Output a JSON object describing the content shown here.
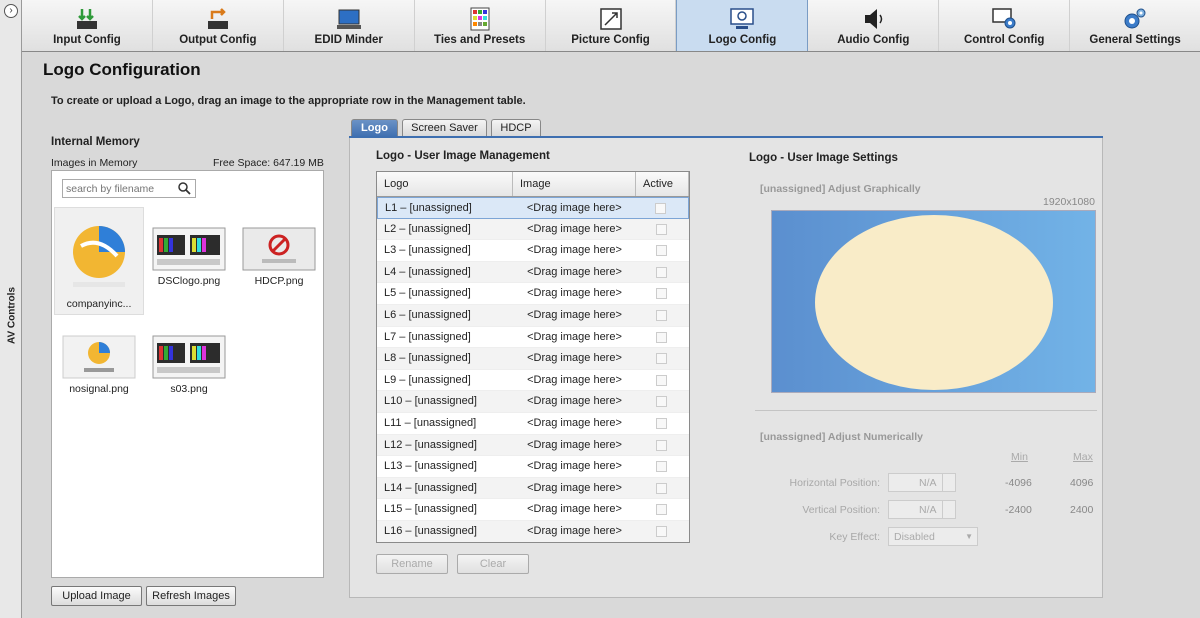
{
  "side": {
    "label": "AV Controls"
  },
  "nav": [
    {
      "label": "Input Config"
    },
    {
      "label": "Output Config"
    },
    {
      "label": "EDID Minder"
    },
    {
      "label": "Ties and Presets"
    },
    {
      "label": "Picture Config"
    },
    {
      "label": "Logo Config",
      "active": true
    },
    {
      "label": "Audio Config"
    },
    {
      "label": "Control Config"
    },
    {
      "label": "General Settings"
    }
  ],
  "page": {
    "title": "Logo Configuration",
    "instruction": "To create or upload a Logo, drag an image to the appropriate row in the Management table."
  },
  "memory": {
    "title": "Internal Memory",
    "images_label": "Images in Memory",
    "free_space": "Free Space: 647.19 MB",
    "search_placeholder": "search by filename",
    "images": [
      {
        "name": "companyinc...",
        "icon": "company-logo-icon"
      },
      {
        "name": "DSClogo.png",
        "icon": "screenshot-icon"
      },
      {
        "name": "HDCP.png",
        "icon": "no-signal-icon"
      },
      {
        "name": "nosignal.png",
        "icon": "company-logo-icon"
      },
      {
        "name": "s03.png",
        "icon": "screenshot-icon"
      }
    ],
    "upload_label": "Upload Image",
    "refresh_label": "Refresh Images"
  },
  "tabs": [
    {
      "label": "Logo",
      "active": true
    },
    {
      "label": "Screen Saver"
    },
    {
      "label": "HDCP"
    }
  ],
  "management": {
    "title": "Logo - User Image Management",
    "columns": [
      "Logo",
      "Image",
      "Active"
    ],
    "rows": [
      {
        "logo": "L1  – [unassigned]",
        "image": "<Drag image here>"
      },
      {
        "logo": "L2  – [unassigned]",
        "image": "<Drag image here>"
      },
      {
        "logo": "L3  – [unassigned]",
        "image": "<Drag image here>"
      },
      {
        "logo": "L4  – [unassigned]",
        "image": "<Drag image here>"
      },
      {
        "logo": "L5  – [unassigned]",
        "image": "<Drag image here>"
      },
      {
        "logo": "L6  – [unassigned]",
        "image": "<Drag image here>"
      },
      {
        "logo": "L7  – [unassigned]",
        "image": "<Drag image here>"
      },
      {
        "logo": "L8  – [unassigned]",
        "image": "<Drag image here>"
      },
      {
        "logo": "L9  – [unassigned]",
        "image": "<Drag image here>"
      },
      {
        "logo": "L10  – [unassigned]",
        "image": "<Drag image here>"
      },
      {
        "logo": "L11  – [unassigned]",
        "image": "<Drag image here>"
      },
      {
        "logo": "L12  – [unassigned]",
        "image": "<Drag image here>"
      },
      {
        "logo": "L13  – [unassigned]",
        "image": "<Drag image here>"
      },
      {
        "logo": "L14  – [unassigned]",
        "image": "<Drag image here>"
      },
      {
        "logo": "L15  – [unassigned]",
        "image": "<Drag image here>"
      },
      {
        "logo": "L16  – [unassigned]",
        "image": "<Drag image here>"
      }
    ],
    "rename_label": "Rename",
    "clear_label": "Clear"
  },
  "settings": {
    "title": "Logo - User Image Settings",
    "graphical_label": "[unassigned]  Adjust Graphically",
    "resolution": "1920x1080",
    "numeric_label": "[unassigned]  Adjust Numerically",
    "min_label": "Min",
    "max_label": "Max",
    "hpos_label": "Horizontal Position:",
    "vpos_label": "Vertical Position:",
    "key_label": "Key Effect:",
    "hpos_value": "N/A",
    "vpos_value": "N/A",
    "key_value": "Disabled",
    "hmin": "-4096",
    "hmax": "4096",
    "vmin": "-2400",
    "vmax": "2400"
  }
}
